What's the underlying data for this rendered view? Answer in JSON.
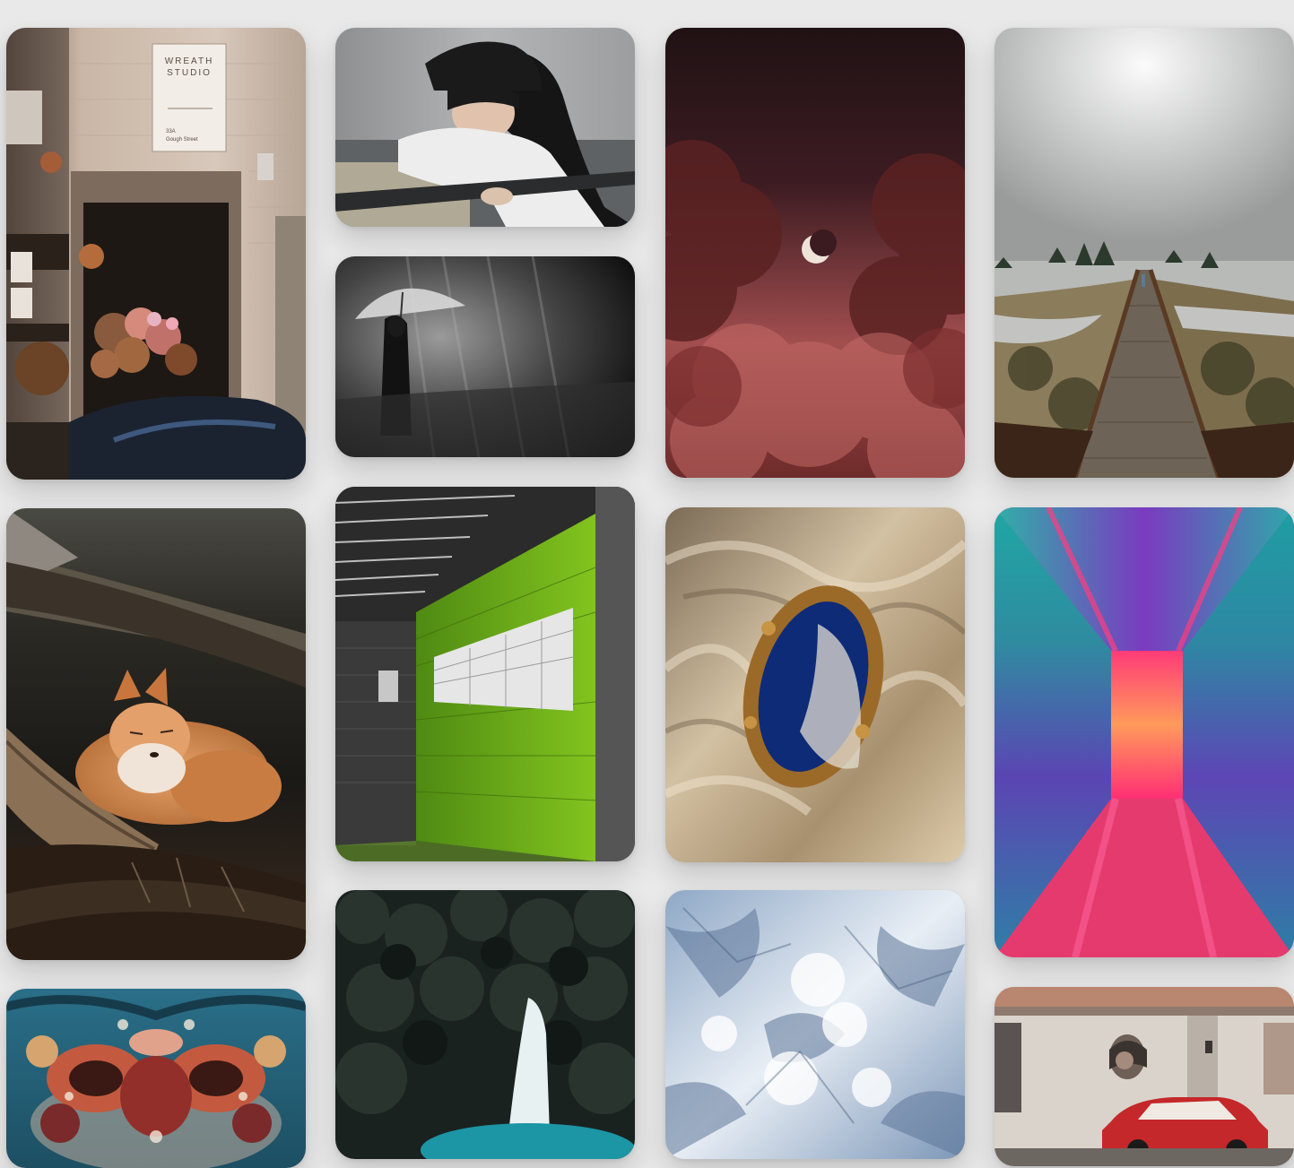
{
  "gallery": {
    "cards": [
      {
        "id": "flower-shop",
        "subject": "storefront with flower displays",
        "sign_line1": "WREATH",
        "sign_line2": "STUDIO",
        "sign_addr1": "33A",
        "sign_addr2": "Gough Street"
      },
      {
        "id": "girl-railing",
        "subject": "woman leaning on railing"
      },
      {
        "id": "umbrella-rain",
        "subject": "black and white figure with umbrella"
      },
      {
        "id": "moon-clouds",
        "subject": "crescent moon among red clouds"
      },
      {
        "id": "boardwalk-lake",
        "subject": "wooden boardwalk through lake landscape"
      },
      {
        "id": "fox",
        "subject": "red fox resting under a log"
      },
      {
        "id": "green-corridor",
        "subject": "green tiled corridor"
      },
      {
        "id": "mirror-satin",
        "subject": "ornate gold mirror on satin fabric"
      },
      {
        "id": "neon-hallway",
        "subject": "neon lit hallway"
      },
      {
        "id": "abstract-fluid",
        "subject": "symmetric abstract fluid art"
      },
      {
        "id": "waterfall",
        "subject": "waterfall in dark forest"
      },
      {
        "id": "snow-mountains",
        "subject": "aerial view of snowy mountains"
      },
      {
        "id": "havana-car",
        "subject": "red vintage car in front of mural"
      }
    ]
  }
}
